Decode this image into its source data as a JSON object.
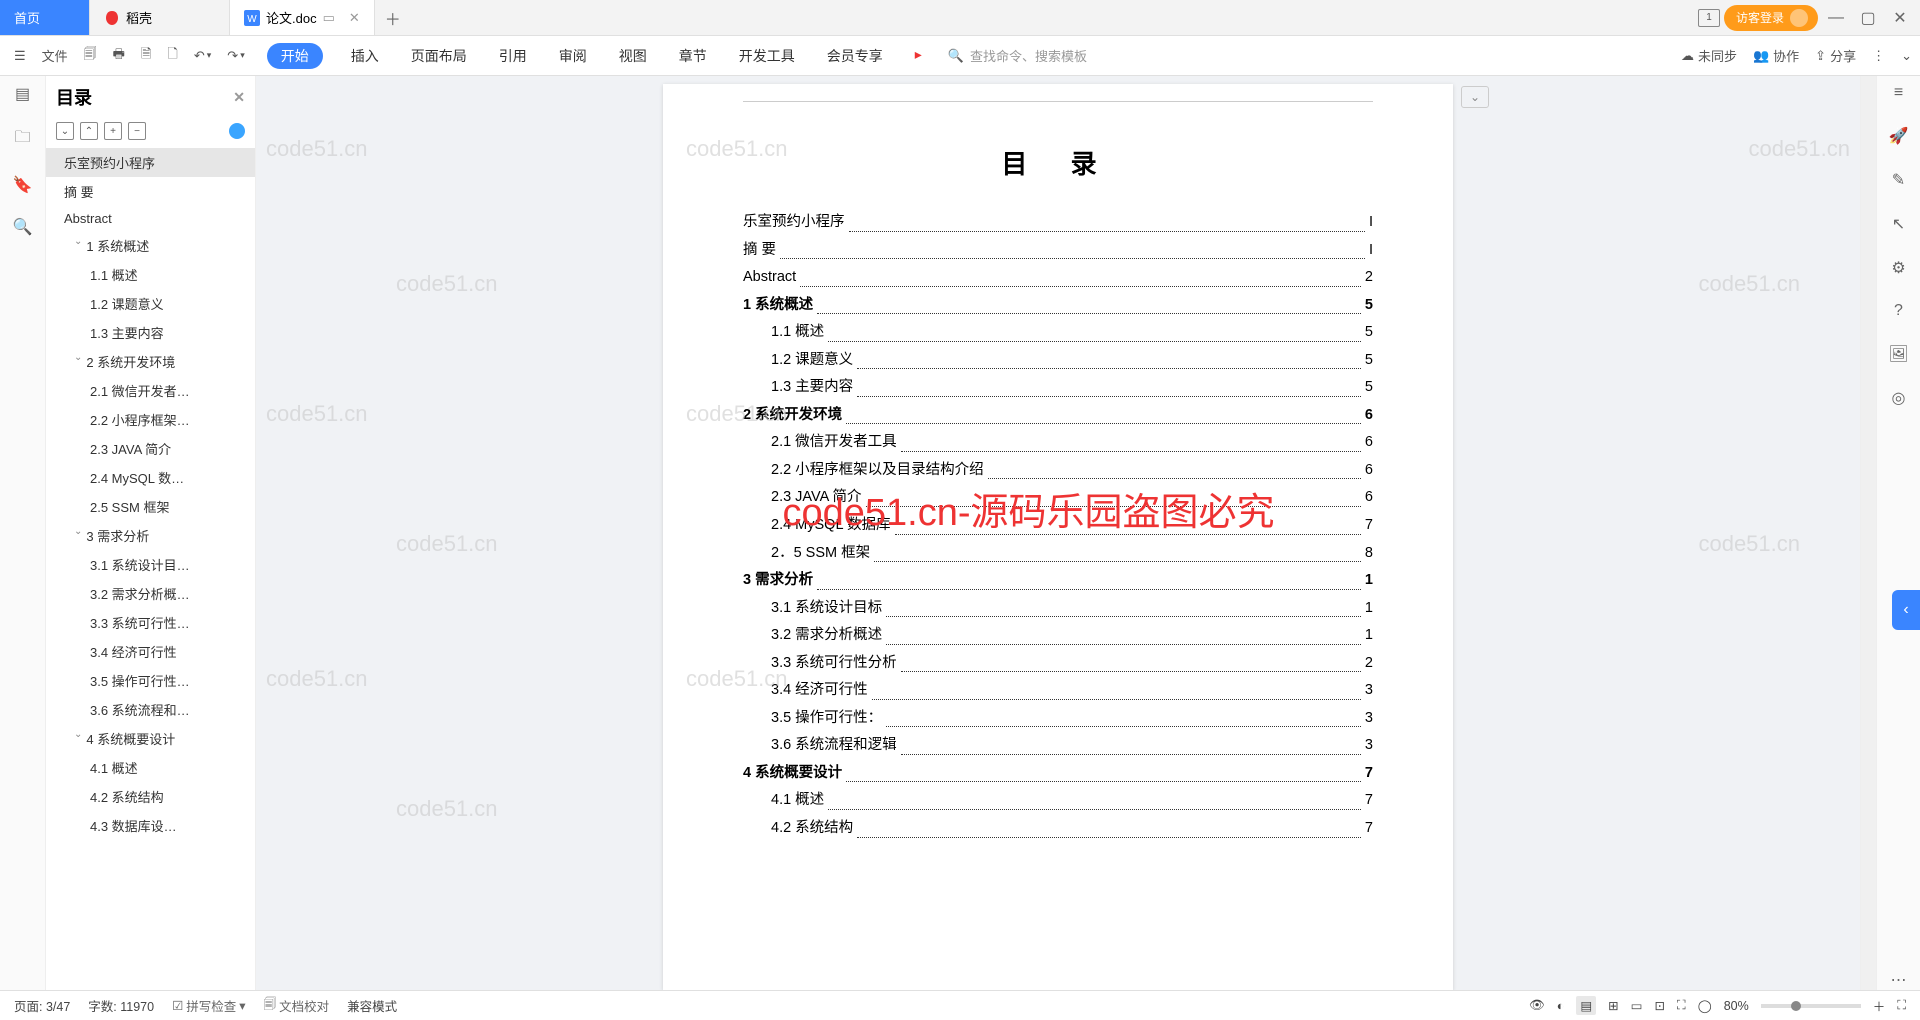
{
  "tabs": {
    "home": "首页",
    "dao": "稻壳",
    "doc": "论文.doc"
  },
  "login": "访客登录",
  "ribbon": {
    "file": "文件",
    "menus": [
      "开始",
      "插入",
      "页面布局",
      "引用",
      "审阅",
      "视图",
      "章节",
      "开发工具",
      "会员专享"
    ],
    "search_ph": "查找命令、搜索模板",
    "sync": "未同步",
    "coop": "协作",
    "share": "分享"
  },
  "outline": {
    "title": "目录",
    "items": [
      {
        "t": "乐室预约小程序",
        "l": 1,
        "sel": true
      },
      {
        "t": "摘  要",
        "l": 1
      },
      {
        "t": "Abstract",
        "l": 1
      },
      {
        "t": "1  系统概述",
        "l": 2,
        "chev": true
      },
      {
        "t": "1.1 概述",
        "l": 3
      },
      {
        "t": "1.2 课题意义",
        "l": 3
      },
      {
        "t": "1.3 主要内容",
        "l": 3
      },
      {
        "t": "2  系统开发环境",
        "l": 2,
        "chev": true
      },
      {
        "t": "2.1 微信开发者…",
        "l": 3
      },
      {
        "t": "2.2 小程序框架…",
        "l": 3
      },
      {
        "t": "2.3 JAVA 简介",
        "l": 3
      },
      {
        "t": "2.4 MySQL 数…",
        "l": 3
      },
      {
        "t": "2.5 SSM 框架",
        "l": 3
      },
      {
        "t": "3  需求分析",
        "l": 2,
        "chev": true
      },
      {
        "t": "3.1 系统设计目…",
        "l": 3
      },
      {
        "t": "3.2 需求分析概…",
        "l": 3
      },
      {
        "t": "3.3  系统可行性…",
        "l": 3
      },
      {
        "t": "3.4 经济可行性",
        "l": 3
      },
      {
        "t": "3.5 操作可行性…",
        "l": 3
      },
      {
        "t": "3.6 系统流程和…",
        "l": 3
      },
      {
        "t": "4 系统概要设计",
        "l": 2,
        "chev": true
      },
      {
        "t": "4.1  概述",
        "l": 3
      },
      {
        "t": "4.2  系统结构",
        "l": 3
      },
      {
        "t": "4.3  数据库设…",
        "l": 3
      }
    ]
  },
  "doc": {
    "title": "目  录",
    "toc": [
      {
        "t": "乐室预约小程序",
        "p": "I",
        "b": false
      },
      {
        "t": "摘  要",
        "p": "I",
        "b": false
      },
      {
        "t": "Abstract",
        "p": "2",
        "b": false
      },
      {
        "t": "1  系统概述",
        "p": "5",
        "b": true
      },
      {
        "t": "1.1  概述",
        "p": "5",
        "i": 1
      },
      {
        "t": "1.2  课题意义",
        "p": "5",
        "i": 1
      },
      {
        "t": "1.3  主要内容",
        "p": "5",
        "i": 1
      },
      {
        "t": "2  系统开发环境",
        "p": "6",
        "b": true
      },
      {
        "t": "2.1 微信开发者工具",
        "p": "6",
        "i": 1
      },
      {
        "t": "2.2 小程序框架以及目录结构介绍",
        "p": "6",
        "i": 1
      },
      {
        "t": "2.3 JAVA 简介",
        "p": "6",
        "i": 1
      },
      {
        "t": "2.4 MySQL 数据库",
        "p": "7",
        "i": 1
      },
      {
        "t": "2．5  SSM 框架",
        "p": "8",
        "i": 1
      },
      {
        "t": "3  需求分析",
        "p": "1",
        "b": true
      },
      {
        "t": "3.1  系统设计目标",
        "p": "1",
        "i": 1
      },
      {
        "t": "3.2 需求分析概述",
        "p": "1",
        "i": 1
      },
      {
        "t": "3.3  系统可行性分析",
        "p": "2",
        "i": 1
      },
      {
        "t": "3.4 经济可行性",
        "p": "3",
        "i": 1
      },
      {
        "t": "3.5 操作可行性：",
        "p": "3",
        "i": 1
      },
      {
        "t": "3.6 系统流程和逻辑",
        "p": "3",
        "i": 1
      },
      {
        "t": "4 系统概要设计",
        "p": "7",
        "b": true
      },
      {
        "t": "4.1  概述",
        "p": "7",
        "i": 1
      },
      {
        "t": "4.2  系统结构",
        "p": "7",
        "i": 1
      }
    ]
  },
  "watermarks": [
    "code51.cn",
    "code51.cn",
    "code51.cn",
    "code51.cn",
    "code51.cn",
    "code51.cn",
    "code51.cn",
    "code51.cn",
    "code51.cn",
    "code51.cn",
    "code51.cn",
    "code51.cn"
  ],
  "bigwm": "code51.cn-源码乐园盗图必究",
  "status": {
    "page": "页面: 3/47",
    "words": "字数: 11970",
    "spell": "拼写检查",
    "proof": "文档校对",
    "compat": "兼容模式",
    "zoom": "80%"
  }
}
